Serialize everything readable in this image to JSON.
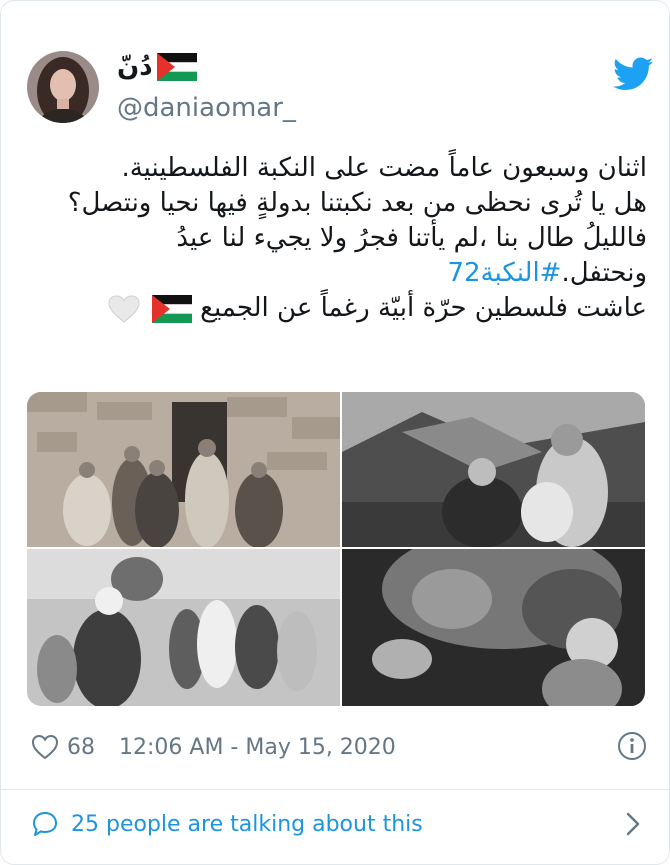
{
  "author": {
    "display_name": "دُنّ",
    "username": "@daniaomar_"
  },
  "tweet": {
    "lines": [
      "اثنان وسبعون عاماً مضت على النكبة الفلسطينية.",
      "هل يا تُرى نحظى من بعد نكبتنا بدولةٍ فيها نحيا ونتصل؟",
      "فالليلُ طال بنا ،لم يأتنا فجرُ ولا يجيء لنا عيدُ"
    ],
    "line4_text": "ونحتفل.",
    "hashtag": "#النكبة72",
    "line5_text": "عاشت فلسطين حرّة أبيّة رغماً عن الجميع"
  },
  "media": {
    "photos": [
      "historic-family-photo",
      "elderly-man-tent-photo",
      "refugees-walking-photo",
      "child-with-elder-photo"
    ]
  },
  "footer": {
    "like_count": "68",
    "timestamp": "12:06 AM - May 15, 2020",
    "talking_text": "25 people are talking about this"
  },
  "colors": {
    "link": "#1b95e0",
    "muted": "#657786",
    "twitter_blue": "#1da1f2",
    "flag_red": "#e4312b",
    "flag_green": "#149954"
  }
}
